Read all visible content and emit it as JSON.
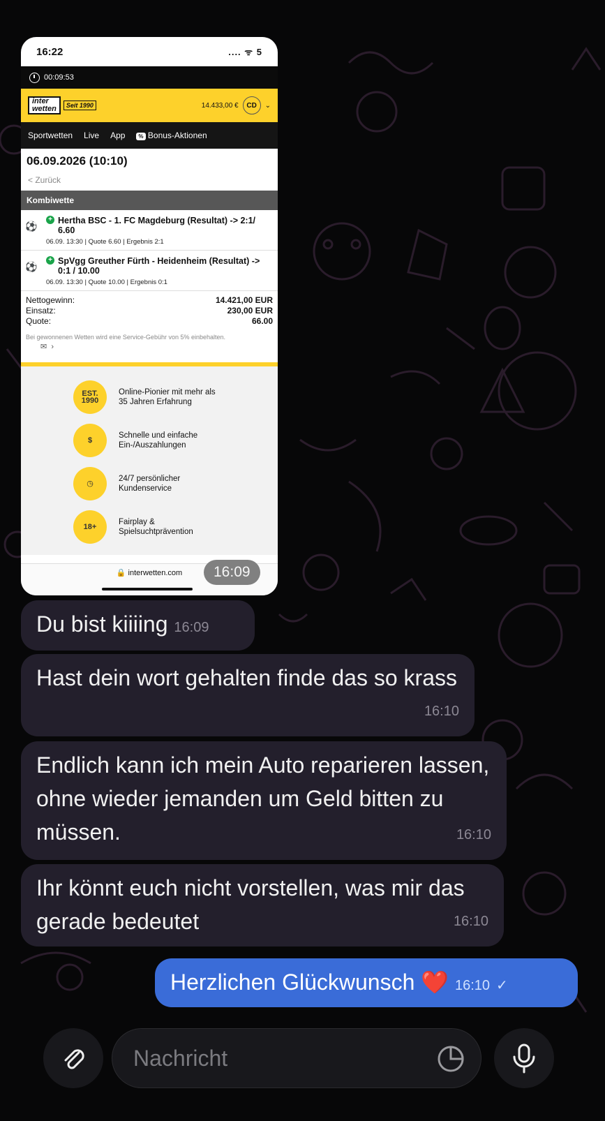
{
  "screenshot": {
    "status_time": "16:22",
    "status_right": ".... ᯤ 5",
    "timer": "00:09:53",
    "logo_top": "inter",
    "logo_bottom": "wetten",
    "logo_since": "Seit 1990",
    "balance": "14.433,00 €",
    "avatar_initials": "CD",
    "nav": [
      "Sportwetten",
      "Live",
      "App",
      "Bonus-Aktionen"
    ],
    "date_title": "06.09.2026 (10:10)",
    "back_link": "< Zurück",
    "section": "Kombiwette",
    "bets": [
      {
        "title": "Hertha BSC - 1. FC Magdeburg (Resultat) -> 2:1/ 6.60",
        "meta": "06.09. 13:30 | Quote 6.60 | Ergebnis 2:1"
      },
      {
        "title": "SpVgg Greuther Fürth - Heidenheim (Resultat) -> 0:1 / 10.00",
        "meta": "06.09. 13:30 | Quote 10.00 | Ergebnis 0:1"
      }
    ],
    "totals": [
      {
        "label": "Nettogewinn:",
        "value": "14.421,00 EUR"
      },
      {
        "label": "Einsatz:",
        "value": "230,00 EUR"
      },
      {
        "label": "Quote:",
        "value": "66.00"
      }
    ],
    "fee_note": "Bei gewonnenen Wetten wird eine Service-Gebühr von 5% einbehalten.",
    "features": [
      {
        "icon": "EST. 1990",
        "text": "Online-Pionier mit mehr als 35 Jahren Erfahrung"
      },
      {
        "icon": "hand-coin-icon",
        "text": "Schnelle und einfache Ein-/Auszahlungen"
      },
      {
        "icon": "clock-icon",
        "text": "24/7 persönlicher Kundenservice"
      },
      {
        "icon": "18+",
        "text": "Fairplay & Spielsuchtprävention"
      }
    ],
    "url": "interwetten.com"
  },
  "image_time": "16:09",
  "messages": [
    {
      "text": "Du bist kiiiing",
      "time": "16:09",
      "direction": "in"
    },
    {
      "text": "Hast dein wort gehalten finde das so krass",
      "time": "16:10",
      "direction": "in"
    },
    {
      "text": "Endlich kann ich mein Auto reparieren lassen, ohne wieder jemanden um Geld bitten zu müssen.",
      "time": "16:10",
      "direction": "in"
    },
    {
      "text": "Ihr könnt euch nicht vorstellen, was mir das gerade bedeutet",
      "time": "16:10",
      "direction": "in"
    },
    {
      "text": "Herzlichen Glückwunsch",
      "time": "16:10",
      "direction": "out",
      "emoji": "❤️"
    }
  ],
  "composer": {
    "placeholder": "Nachricht"
  },
  "colors": {
    "background": "#070708",
    "incoming": "#231f2c",
    "outgoing": "#3a6cd8",
    "brand_yellow": "#fdd12b"
  }
}
